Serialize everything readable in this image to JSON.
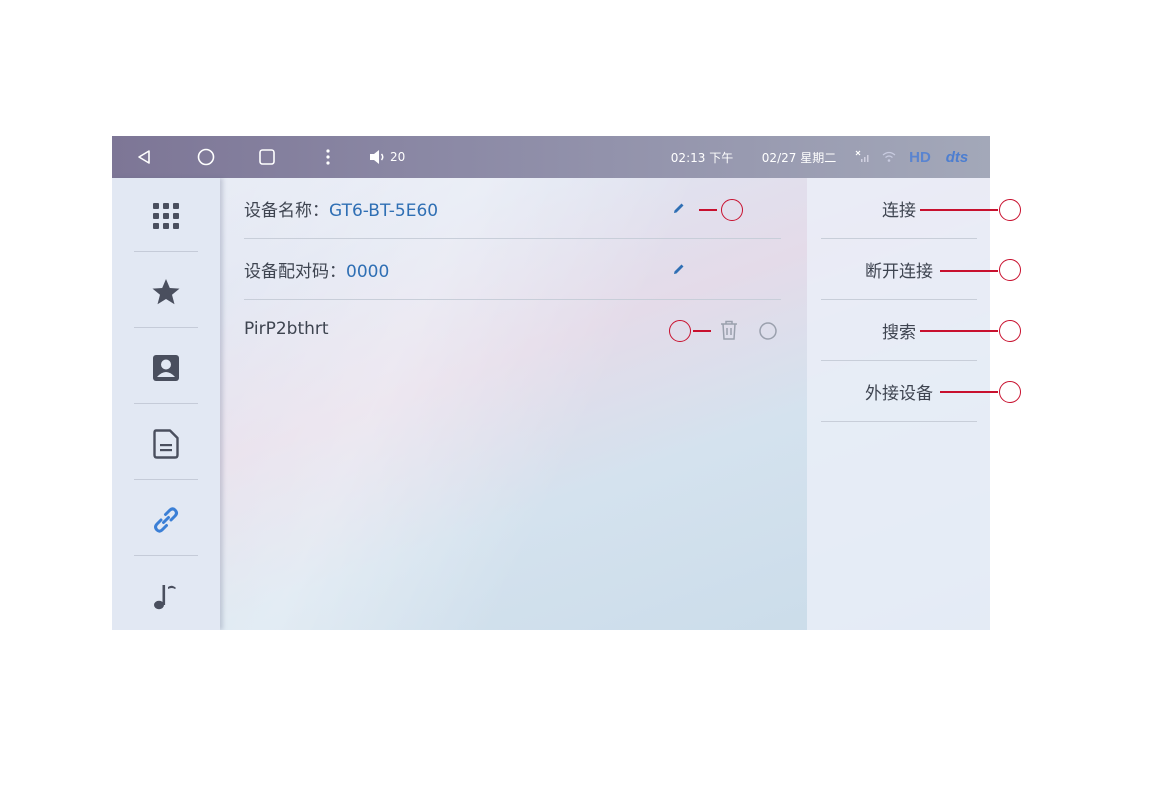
{
  "status_bar": {
    "volume": "20",
    "time": "02:13 下午",
    "date": "02/27 星期二",
    "hd_label": "HD",
    "dts_label": "dts"
  },
  "sidebar": {
    "items": [
      {
        "icon": "apps-grid-icon"
      },
      {
        "icon": "star-icon"
      },
      {
        "icon": "contact-icon"
      },
      {
        "icon": "document-icon"
      },
      {
        "icon": "link-icon",
        "active": true
      },
      {
        "icon": "music-note-icon"
      }
    ]
  },
  "bluetooth": {
    "device_name_label": "设备名称：",
    "device_name_value": "GT6-BT-5E60",
    "pin_label": "设备配对码：",
    "pin_value": "0000",
    "paired_device": "PirP2bthrt"
  },
  "actions": {
    "connect": "连接",
    "disconnect": "断开连接",
    "search": "搜索",
    "external_device": "外接设备"
  },
  "colors": {
    "accent_blue": "#2f6fb4",
    "callout_red": "#c8102e",
    "status_bar": "#8c8aa6"
  }
}
